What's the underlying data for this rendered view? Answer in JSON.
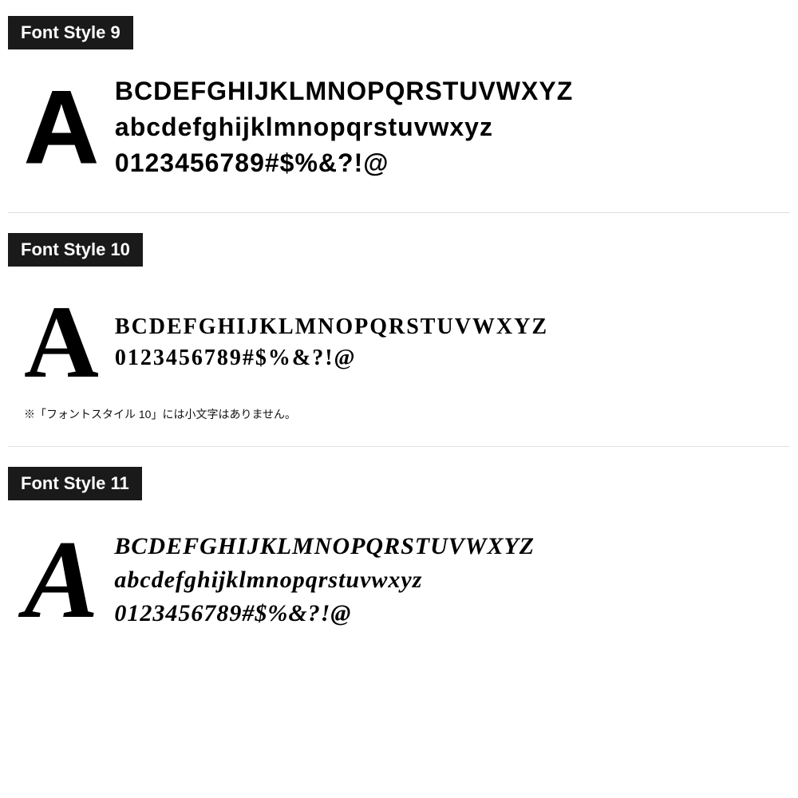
{
  "styles": [
    {
      "id": "font-style-9",
      "label": "Font Style 9",
      "big_letter": "A",
      "lines": [
        "BCDEFGHIJKLMNOPQRSTUVWXYZ",
        "abcdefghijklmnopqrstuvwxyz",
        "0123456789#$%&?!@"
      ],
      "note": null
    },
    {
      "id": "font-style-10",
      "label": "Font Style 10",
      "big_letter": "A",
      "lines": [
        "BCDEFGHIJKLMNOPQRSTUVWXYZ",
        "0123456789#$%&?!@"
      ],
      "note": "※「フォントスタイル 10」には小文字はありません。"
    },
    {
      "id": "font-style-11",
      "label": "Font Style 11",
      "big_letter": "A",
      "lines": [
        "BCDEFGHIJKLMNOPQRSTUVWXYZ",
        "abcdefghijklmnopqrstuvwxyz",
        "0123456789#$%&?!@"
      ],
      "note": null
    }
  ]
}
